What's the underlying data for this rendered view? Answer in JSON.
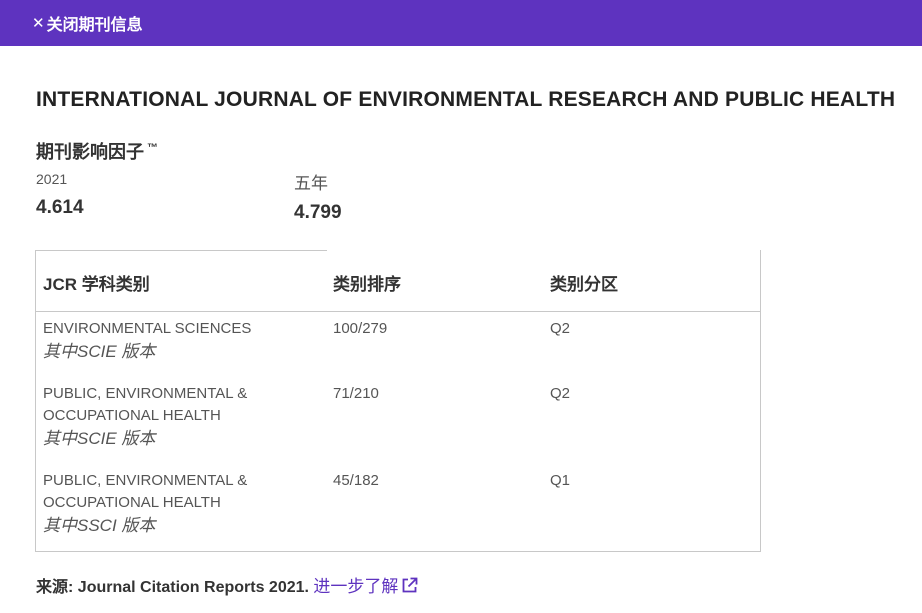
{
  "topbar": {
    "close_icon": "close-icon",
    "close_label": "关闭期刊信息",
    "bg_color": "#5e33bf"
  },
  "journal": {
    "title": "INTERNATIONAL JOURNAL OF ENVIRONMENTAL RESEARCH AND PUBLIC HEALTH"
  },
  "impact_factor": {
    "heading": "期刊影响因子",
    "tm": "™",
    "metrics": [
      {
        "label": "2021",
        "value": "4.614"
      },
      {
        "label": "五年",
        "value": "4.799"
      }
    ]
  },
  "jcr_table": {
    "headers": [
      "JCR 学科类别",
      "类别排序",
      "类别分区"
    ],
    "rows": [
      {
        "category_lines": [
          "ENVIRONMENTAL SCIENCES"
        ],
        "edition": "其中SCIE 版本",
        "rank": "100/279",
        "quartile": "Q2"
      },
      {
        "category_lines": [
          "PUBLIC, ENVIRONMENTAL &",
          "OCCUPATIONAL HEALTH"
        ],
        "edition": "其中SCIE 版本",
        "rank": "71/210",
        "quartile": "Q2"
      },
      {
        "category_lines": [
          "PUBLIC, ENVIRONMENTAL &",
          "OCCUPATIONAL HEALTH"
        ],
        "edition": "其中SSCI 版本",
        "rank": "45/182",
        "quartile": "Q1"
      }
    ]
  },
  "source": {
    "label": "来源:",
    "text": "Journal Citation Reports  2021.",
    "link": "进一步了解",
    "link_icon": "external-link-icon",
    "link_color": "#5e33bf"
  }
}
